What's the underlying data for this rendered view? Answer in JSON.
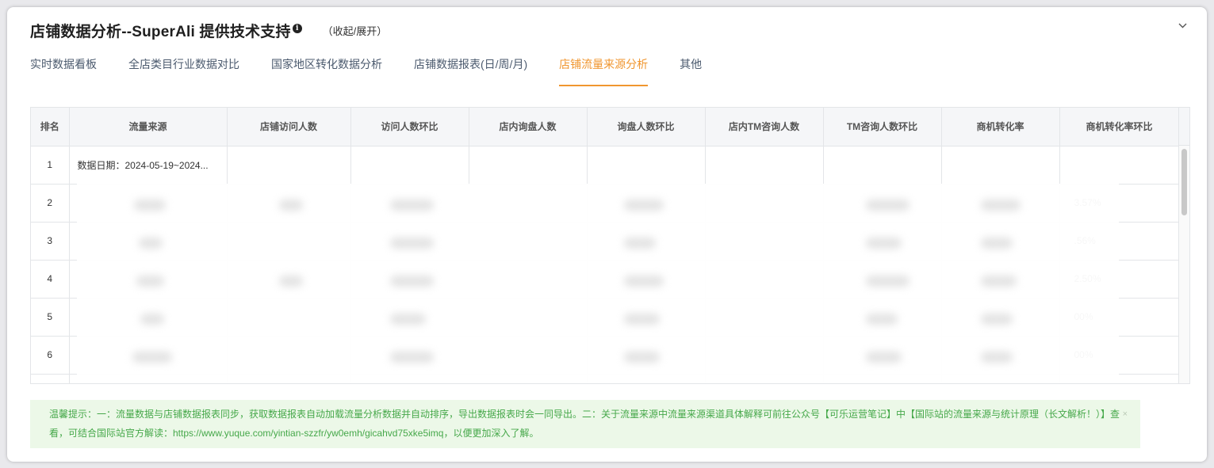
{
  "header": {
    "title": "店铺数据分析--SuperAli 提供技术支持",
    "info_icon": "info-icon",
    "collapse_label": "（收起/展开）",
    "chevron_icon": "chevron-down-icon"
  },
  "tabs": [
    {
      "label": "实时数据看板",
      "active": false
    },
    {
      "label": "全店类目行业数据对比",
      "active": false
    },
    {
      "label": "国家地区转化数据分析",
      "active": false
    },
    {
      "label": "店铺数据报表(日/周/月)",
      "active": false
    },
    {
      "label": "店铺流量来源分析",
      "active": true
    },
    {
      "label": "其他",
      "active": false
    }
  ],
  "table": {
    "columns": [
      "排名",
      "流量来源",
      "店铺访问人数",
      "访问人数环比",
      "店内询盘人数",
      "询盘人数环比",
      "店内TM咨询人数",
      "TM咨询人数环比",
      "商机转化率",
      "商机转化率环比"
    ],
    "rows": [
      {
        "rank": "1",
        "source": "数据日期：2024-05-19~2024...",
        "rate_change": ""
      },
      {
        "rank": "2",
        "source": "",
        "rate_change": "3.57%"
      },
      {
        "rank": "3",
        "source": "",
        "rate_change": ".56%"
      },
      {
        "rank": "4",
        "source": "",
        "rate_change": "2.50%"
      },
      {
        "rank": "5",
        "source": "",
        "rate_change": "00%"
      },
      {
        "rank": "6",
        "source": "",
        "rate_change": "00%"
      }
    ]
  },
  "notice": {
    "text": "温馨提示：一：流量数据与店铺数据报表同步，获取数据报表自动加载流量分析数据并自动排序，导出数据报表时会一同导出。二：关于流量来源中流量来源渠道具体解释可前往公众号【可乐运营笔记】中【国际站的流量来源与统计原理（长文解析！）】查看，可结合国际站官方解读：https://www.yuque.com/yintian-szzfr/yw0emh/gicahvd75xke5imq，以便更加深入了解。",
    "close_icon": "×"
  },
  "colors": {
    "accent": "#f0962f",
    "notice_bg": "#ecf8e8",
    "notice_text": "#46a84a"
  }
}
